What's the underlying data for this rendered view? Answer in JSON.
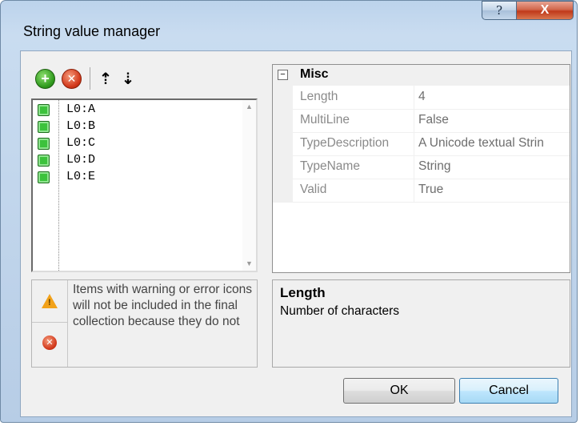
{
  "window": {
    "title": "String value manager",
    "help_glyph": "?",
    "close_glyph": "X"
  },
  "toolbar": {
    "add_icon": "add-circle-icon",
    "remove_icon": "remove-circle-icon",
    "up_glyph": "⇡",
    "down_glyph": "⇣"
  },
  "items": [
    {
      "label": "L0:A"
    },
    {
      "label": "L0:B"
    },
    {
      "label": "L0:C"
    },
    {
      "label": "L0:D"
    },
    {
      "label": "L0:E"
    }
  ],
  "info": {
    "text": "Items with warning or error icons will not be included in the final collection because they do not"
  },
  "properties": {
    "category": "Misc",
    "toggle_glyph": "−",
    "rows": [
      {
        "name": "Length",
        "value": "4"
      },
      {
        "name": "MultiLine",
        "value": "False"
      },
      {
        "name": "TypeDescription",
        "value": "A Unicode textual Strin"
      },
      {
        "name": "TypeName",
        "value": "String"
      },
      {
        "name": "Valid",
        "value": "True"
      }
    ]
  },
  "description": {
    "title": "Length",
    "text": "Number of characters"
  },
  "buttons": {
    "ok": "OK",
    "cancel": "Cancel"
  },
  "colors": {
    "item_status": "#3cc23c",
    "warning": "#f2a21a",
    "error": "#d2381b"
  }
}
